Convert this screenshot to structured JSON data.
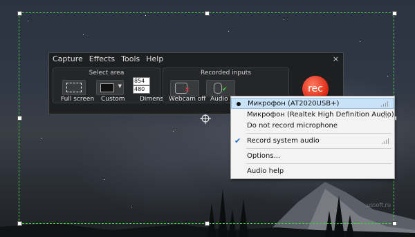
{
  "menubar": {
    "items": [
      "Capture",
      "Effects",
      "Tools",
      "Help"
    ],
    "close_glyph": "×"
  },
  "select_area": {
    "title": "Select area",
    "full_screen_label": "Full screen",
    "custom_label": "Custom",
    "dimensions_label": "Dimensio",
    "width_value": "854",
    "height_value": "480"
  },
  "recorded_inputs": {
    "title": "Recorded inputs",
    "webcam_label": "Webcam off",
    "audio_label": "Audio on"
  },
  "rec_button": {
    "label": "rec"
  },
  "audio_menu": {
    "items": [
      {
        "label": "Микрофон (AT2020USB+)",
        "state": "selected"
      },
      {
        "label": "Микрофон (Realtek High Definition Audio)"
      },
      {
        "label": "Do not record microphone"
      },
      {
        "label": "Record system audio",
        "state": "checked"
      },
      {
        "label": "Options..."
      },
      {
        "label": "Audio help"
      }
    ]
  },
  "watermark": {
    "text": "ussoft.ru"
  },
  "colors": {
    "accent_green": "#43d13f",
    "rec_red": "#e3311c",
    "menu_highlight": "#c9e2f7"
  },
  "icons": [
    "monitor-icon",
    "custom-area-icon",
    "webcam-icon",
    "microphone-icon",
    "check-icon",
    "bullet-icon",
    "volume-bars-icon",
    "crosshair-icon"
  ]
}
